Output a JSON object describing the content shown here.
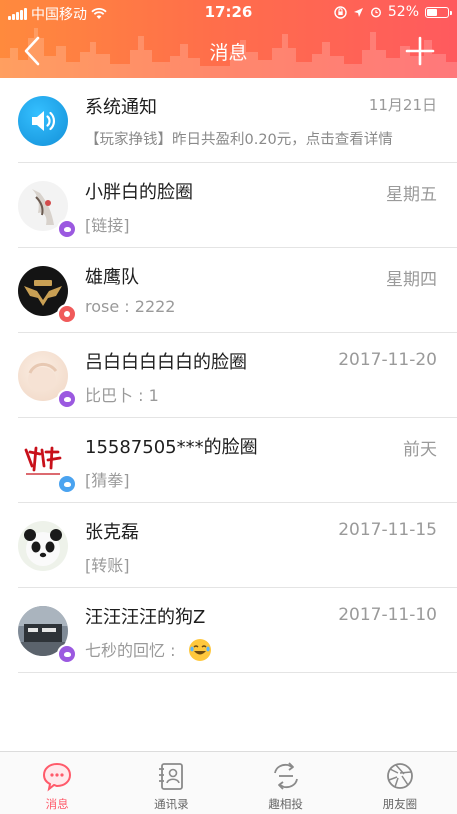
{
  "status_bar": {
    "carrier": "中国移动",
    "time": "17:26",
    "battery": "52%",
    "battery_level": 0.52
  },
  "header": {
    "title": "消息"
  },
  "messages": [
    {
      "title": "系统通知",
      "time": "11月21日",
      "subtitle": "【玩家挣钱】昨日共盈利0.20元，点击查看详情",
      "avatar": "speaker-icon",
      "badge": "",
      "color": "#1ba6e8"
    },
    {
      "title": "小胖白的脸圈",
      "time": "星期五",
      "subtitle": "[链接]",
      "avatar": "user-photo",
      "badge": "purple",
      "color": "#9b59e0"
    },
    {
      "title": "雄鹰队",
      "time": "星期四",
      "subtitle": "rose : 2222",
      "avatar": "eagle-logo",
      "badge": "red",
      "color": "#f05a5a"
    },
    {
      "title": "吕白白白白白的脸圈",
      "time": "2017-11-20",
      "subtitle": "比巴卜 : 1",
      "avatar": "user-photo",
      "badge": "purple",
      "color": "#9b59e0"
    },
    {
      "title": "15587505***的脸圈",
      "time": "前天",
      "subtitle": "[猜拳]",
      "avatar": "calligraphy-logo",
      "badge": "blue",
      "color": "#4aa3f0"
    },
    {
      "title": "张克磊",
      "time": "2017-11-15",
      "subtitle": "[转账]",
      "avatar": "panda-photo",
      "badge": "",
      "color": ""
    },
    {
      "title": "汪汪汪汪的狗Z",
      "time": "2017-11-10",
      "subtitle": "七秒的回忆 :",
      "avatar": "user-photo",
      "badge": "purple",
      "color": "#9b59e0",
      "emoji": "laughing-emoji"
    }
  ],
  "tabbar": {
    "tabs": [
      {
        "label": "消息",
        "icon": "chat-bubble-icon",
        "active": true
      },
      {
        "label": "通讯录",
        "icon": "contacts-book-icon",
        "active": false
      },
      {
        "label": "趣相投",
        "icon": "exchange-arrows-icon",
        "active": false
      },
      {
        "label": "朋友圈",
        "icon": "camera-shutter-icon",
        "active": false
      }
    ]
  },
  "colors": {
    "header_start": "#ff8a3d",
    "header_end": "#ff5a5e",
    "accent": "#ff5a6a"
  }
}
